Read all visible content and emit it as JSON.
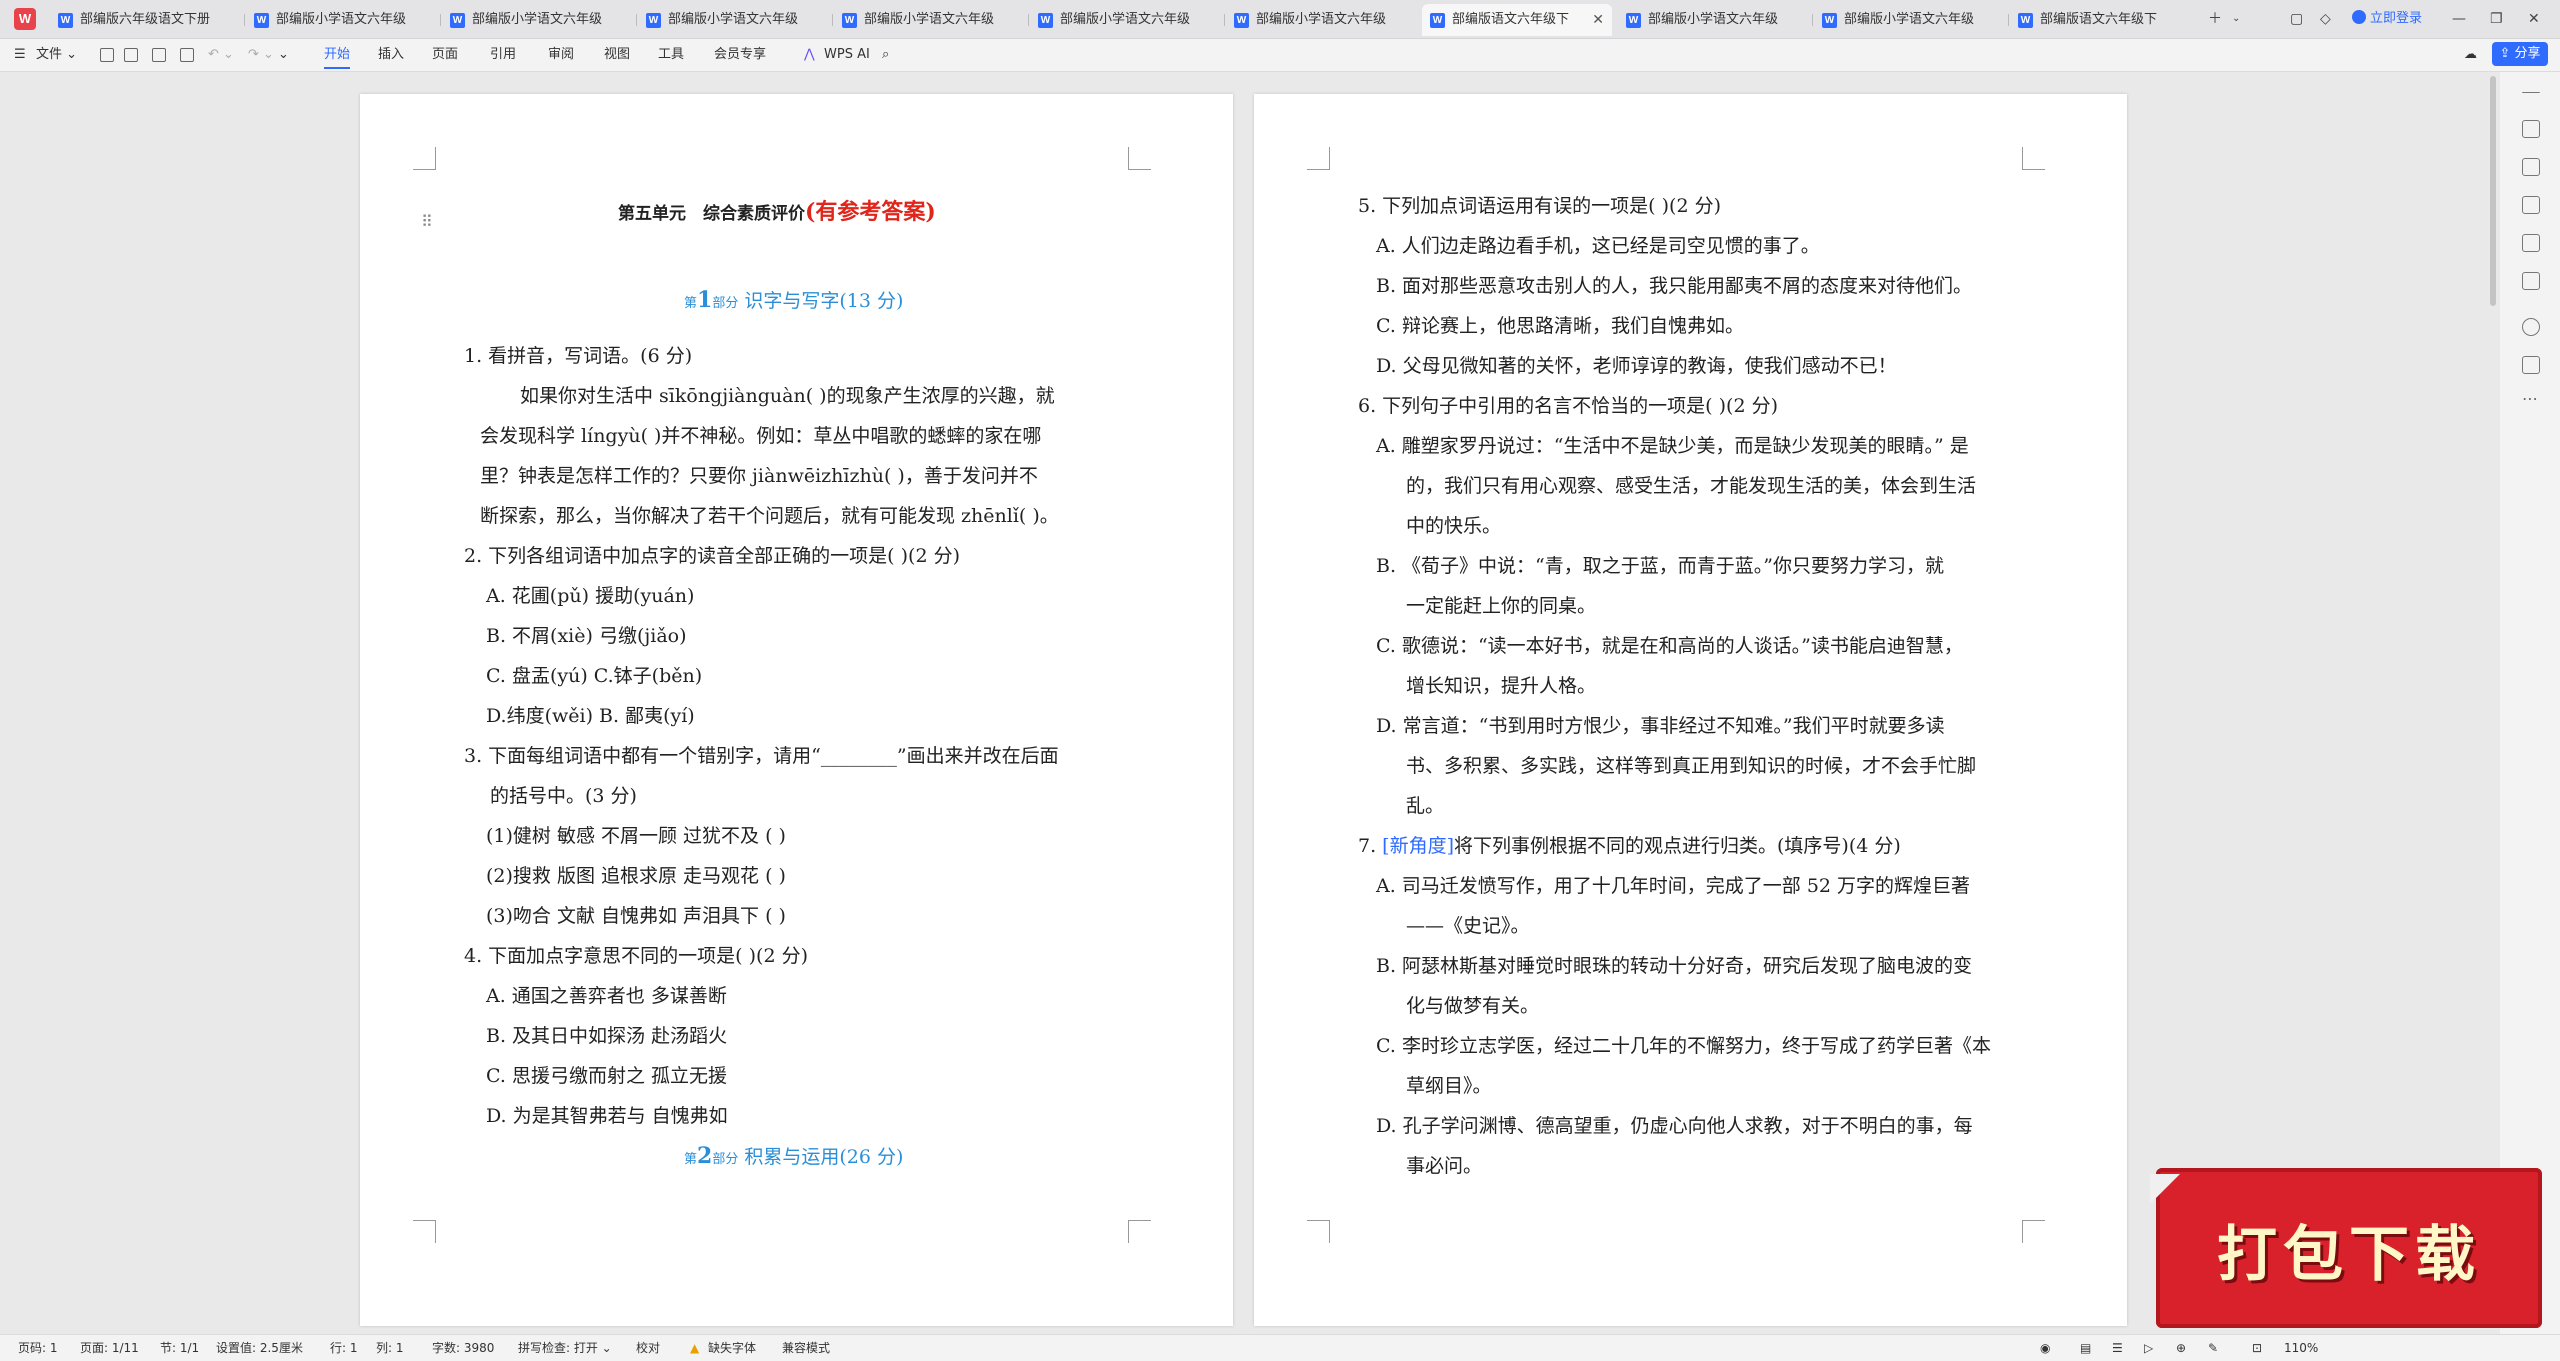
{
  "tabs": [
    {
      "label": "部编版六年级语文下册第五单元",
      "active": false
    },
    {
      "label": "部编版小学语文六年级下册第五",
      "active": false
    },
    {
      "label": "部编版小学语文六年级下册第五",
      "active": false
    },
    {
      "label": "部编版小学语文六年级下册第五",
      "active": false
    },
    {
      "label": "部编版小学语文六年级下册第五",
      "active": false
    },
    {
      "label": "部编版小学语文六年级下册第五",
      "active": false
    },
    {
      "label": "部编版小学语文六年级下册第五",
      "active": false
    },
    {
      "label": "部编版语文六年级下",
      "active": true
    },
    {
      "label": "部编版小学语文六年级下册第五",
      "active": false
    },
    {
      "label": "部编版小学语文六年级下册第五",
      "active": false
    },
    {
      "label": "部编版语文六年级下",
      "active": false
    }
  ],
  "login_label": "立即登录",
  "menu": {
    "file": "文件",
    "items": [
      "开始",
      "插入",
      "页面",
      "引用",
      "审阅",
      "视图",
      "工具",
      "会员专享"
    ],
    "wps_ai": "WPS AI",
    "share": "分享"
  },
  "page1": {
    "title": "第五单元　综合素质评价",
    "title_note": "(有参考答案)",
    "sec1": {
      "pre": "第",
      "num": "1",
      "tag": "部分",
      "label": "识字与写字(13 分)"
    },
    "q1": "1.  看拼音，写词语。(6 分)",
    "q1_l1": "如果你对生活中 sīkōngjiànguàn(              )的现象产生浓厚的兴趣，就",
    "q1_l2": "会发现科学 língyù(          )并不神秘。例如：草丛中唱歌的蟋蟀的家在哪",
    "q1_l3": "里？钟表是怎样工作的？只要你 jiànwēizhīzhù(              )，善于发问并不",
    "q1_l4": "断探索，那么，当你解决了若干个问题后，就有可能发现 zhēnlǐ(              )。",
    "q2": "2.  下列各组词语中加点字的读音全部正确的一项是(        )(2 分)",
    "q2_a": "A.  花圃(pǔ)      援助(yuán)",
    "q2_b": "B.  不屑(xiè)      弓缴(jiǎo)",
    "q2_c": "C.  盘盂(yú)      C.钵子(běn)",
    "q2_d": "D.纬度(wěi)      B.  鄙夷(yí)",
    "q3": "3.  下面每组词语中都有一个错别字，请用“________”画出来并改在后面",
    "q3_cont": "的括号中。(3 分)",
    "q3_1": "(1)健树        敏感     不屑一顾  过犹不及  (        )",
    "q3_2": "(2)搜救        版图     追根求原  走马观花  (        )",
    "q3_3": "(3)吻合        文献     自愧弗如  声泪具下  (        )",
    "q4": "4.  下面加点字意思不同的一项是(        )(2 分)",
    "q4_a": "A.  通国之善弈者也                    多谋善断",
    "q4_b": "B.  及其日中如探汤                    赴汤蹈火",
    "q4_c": "C.  思援弓缴而射之                    孤立无援",
    "q4_d": "D.  为是其智弗若与                    自愧弗如",
    "sec2": {
      "pre": "第",
      "num": "2",
      "tag": "部分",
      "label": "积累与运用(26 分)"
    }
  },
  "page2": {
    "q5": "5.  下列加点词语运用有误的一项是(        )(2 分)",
    "q5_a": "A.  人们边走路边看手机，这已经是司空见惯的事了。",
    "q5_b": "B.  面对那些恶意攻击别人的人，我只能用鄙夷不屑的态度来对待他们。",
    "q5_c": "C.  辩论赛上，他思路清晰，我们自愧弗如。",
    "q5_d": "D.  父母见微知著的关怀，老师谆谆的教诲，使我们感动不已！",
    "q6": "6.  下列句子中引用的名言不恰当的一项是(        )(2 分)",
    "q6_a1": "A.  雕塑家罗丹说过：“生活中不是缺少美，而是缺少发现美的眼睛。”  是",
    "q6_a2": "的，我们只有用心观察、感受生活，才能发现生活的美，体会到生活",
    "q6_a3": "中的快乐。",
    "q6_b1": "B.  《荀子》中说：“青，取之于蓝，而青于蓝。”你只要努力学习，就",
    "q6_b2": "一定能赶上你的同桌。",
    "q6_c1": "C.  歌德说：“读一本好书，就是在和高尚的人谈话。”读书能启迪智慧，",
    "q6_c2": "增长知识，提升人格。",
    "q6_d1": "D.  常言道：“书到用时方恨少，事非经过不知难。”我们平时就要多读",
    "q6_d2": "书、多积累、多实践，这样等到真正用到知识的时候，才不会手忙脚",
    "q6_d3": "乱。",
    "q7_num": "7. ",
    "q7_tag": "[新角度]",
    "q7_rest": "将下列事例根据不同的观点进行归类。(填序号)(4 分)",
    "q7_a1": "A.  司马迁发愤写作，用了十几年时间，完成了一部 52 万字的辉煌巨著",
    "q7_a2": "——《史记》。",
    "q7_b1": "B.  阿瑟林斯基对睡觉时眼珠的转动十分好奇，研究后发现了脑电波的变",
    "q7_b2": "化与做梦有关。",
    "q7_c1": "C.  李时珍立志学医，经过二十几年的不懈努力，终于写成了药学巨著《本",
    "q7_c2": "草纲目》。",
    "q7_d1": "D.  孔子学问渊博、德高望重，仍虚心向他人求教，对于不明白的事，每",
    "q7_d2": "事必问。"
  },
  "status": {
    "page": "页码: 1",
    "pages": "页面: 1/11",
    "section": "节: 1/1",
    "setting": "设置值: 2.5厘米",
    "row": "行: 1",
    "col": "列: 1",
    "words": "字数: 3980",
    "spell": "拼写检查: 打开",
    "proof": "校对",
    "missing_font": "缺失字体",
    "compat": "兼容模式",
    "zoom": "110%"
  },
  "promo_text": "打包下载",
  "colors": {
    "accent": "#2f6bff",
    "title_red": "#e0251b",
    "section_blue": "#2a8fd8",
    "promo_red": "#d8212a"
  }
}
